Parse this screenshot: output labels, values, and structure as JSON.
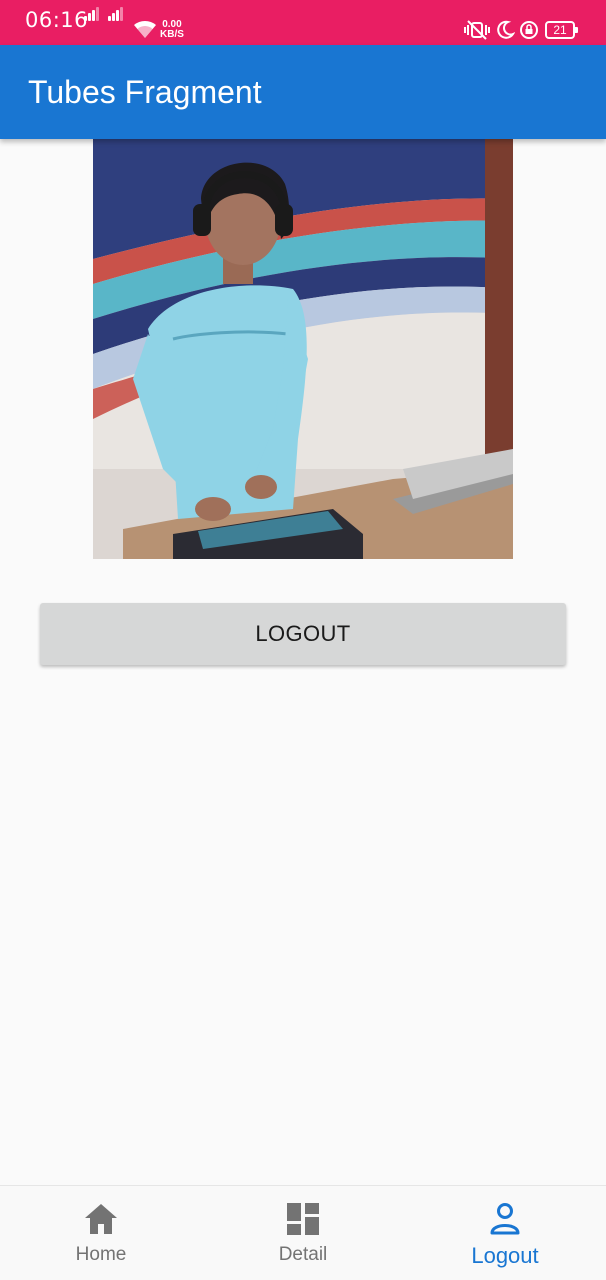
{
  "status_bar": {
    "time": "06:16",
    "net_speed_value": "0.00",
    "net_speed_unit": "KB/S",
    "battery_level": "21",
    "background_color": "#e91e63"
  },
  "app_bar": {
    "title": "Tubes Fragment",
    "background_color": "#1976d2"
  },
  "profile_image": {
    "icon": "profile-photo"
  },
  "logout_button": {
    "label": "LOGOUT"
  },
  "bottom_nav": {
    "active_color": "#1976d2",
    "inactive_color": "#737373",
    "items": [
      {
        "label": "Home",
        "icon": "home-icon",
        "active": false
      },
      {
        "label": "Detail",
        "icon": "dashboard-icon",
        "active": false
      },
      {
        "label": "Logout",
        "icon": "person-icon",
        "active": true
      }
    ]
  }
}
